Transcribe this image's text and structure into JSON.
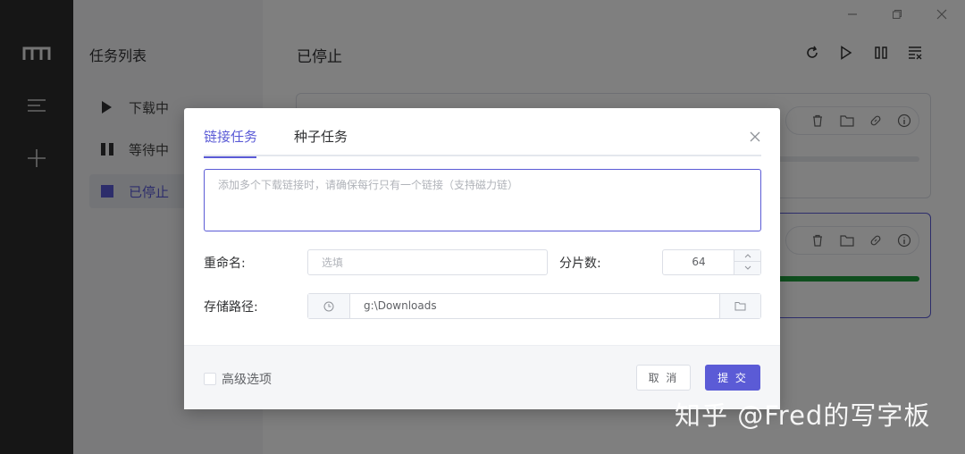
{
  "sidebar": {
    "title": "任务列表",
    "items": [
      {
        "label": "下载中",
        "icon": "play-icon"
      },
      {
        "label": "等待中",
        "icon": "pause-icon"
      },
      {
        "label": "已停止",
        "icon": "stop-icon"
      }
    ]
  },
  "main": {
    "title": "已停止"
  },
  "dialog": {
    "tabs": [
      {
        "label": "链接任务"
      },
      {
        "label": "种子任务"
      }
    ],
    "links_placeholder": "添加多个下载链接时，请确保每行只有一个链接（支持磁力链）",
    "rename_label": "重命名:",
    "rename_placeholder": "选填",
    "split_label": "分片数:",
    "split_value": "64",
    "path_label": "存储路径:",
    "path_value": "g:\\Downloads",
    "advanced_label": "高级选项",
    "cancel_label": "取 消",
    "submit_label": "提 交"
  },
  "watermark": "知乎 @Fred的写字板",
  "colors": {
    "accent": "#5b5bd6",
    "progress": "#1e9d3c",
    "rail": "#2c2c2c"
  }
}
